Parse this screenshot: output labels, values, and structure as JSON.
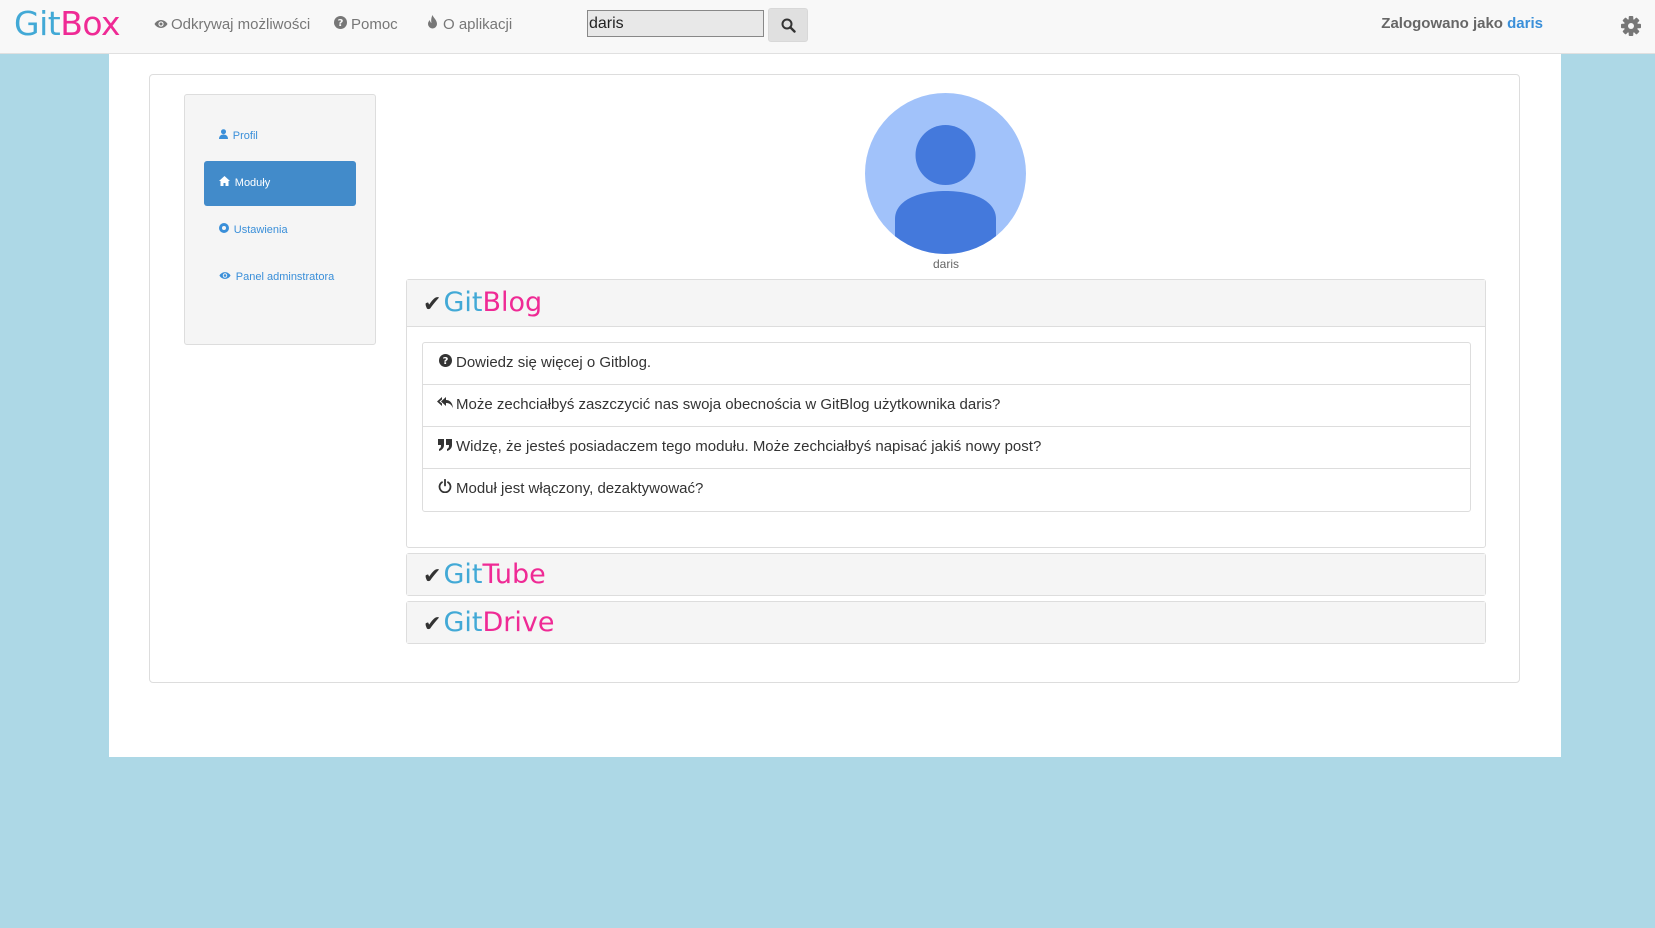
{
  "brand": {
    "part1": "Git",
    "part2": "Box"
  },
  "nav": {
    "links": [
      {
        "label": "Odkrywaj możliwości",
        "icon": "eye-icon"
      },
      {
        "label": "Pomoc",
        "icon": "question-circle-icon"
      },
      {
        "label": "O aplikacji",
        "icon": "fire-icon"
      }
    ]
  },
  "search": {
    "value": "daris"
  },
  "user": {
    "prefix": "Zalogowano jako ",
    "name": "daris"
  },
  "sidebar": {
    "items": [
      {
        "label": "Profil",
        "icon": "user-icon"
      },
      {
        "label": "Moduły",
        "icon": "home-icon"
      },
      {
        "label": "Ustawienia",
        "icon": "settings-circle-icon"
      },
      {
        "label": "Panel adminstratora",
        "icon": "eye-icon"
      }
    ]
  },
  "profile": {
    "name": "daris"
  },
  "modules": [
    {
      "part1": "Git",
      "part2": "Blog",
      "items": [
        {
          "text": "Dowiedz się więcej o Gitblog.",
          "icon": "question-circle-icon"
        },
        {
          "text": "Może zechciałbyś zaszczycić nas swoja obecnościa w GitBlog użytkownika daris?",
          "icon": "reply-all-icon"
        },
        {
          "text": "Widzę, że jesteś posiadaczem tego modułu. Może zechciałbyś napisać jakiś nowy post?",
          "icon": "quote-icon"
        },
        {
          "text": "Moduł jest włączony, dezaktywować?",
          "icon": "power-icon"
        }
      ]
    },
    {
      "part1": "Git",
      "part2": "Tube"
    },
    {
      "part1": "Git",
      "part2": "Drive"
    }
  ],
  "colors": {
    "brand_blue": "#42a9d6",
    "brand_pink": "#ef2a95",
    "link": "#3a8fd9",
    "active": "#428bca",
    "background": "#add8e6"
  }
}
